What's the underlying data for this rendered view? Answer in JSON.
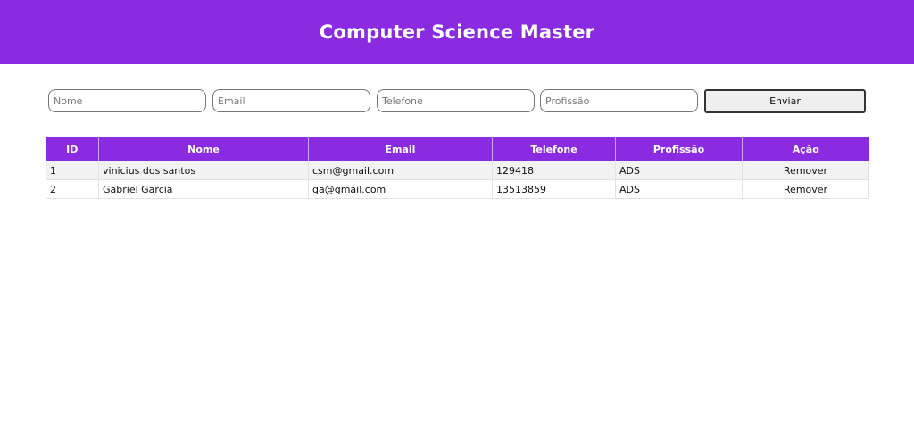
{
  "header": {
    "title": "Computer Science Master"
  },
  "form": {
    "nome_placeholder": "Nome",
    "email_placeholder": "Email",
    "telefone_placeholder": "Telefone",
    "profissao_placeholder": "Profissão",
    "submit_label": "Enviar"
  },
  "table": {
    "headers": [
      "ID",
      "Nome",
      "Email",
      "Telefone",
      "Profissão",
      "Ação"
    ],
    "rows": [
      {
        "id": "1",
        "nome": "vinicius dos santos",
        "email": "csm@gmail.com",
        "telefone": "129418",
        "profissao": "ADS",
        "acao": "Remover"
      },
      {
        "id": "2",
        "nome": "Gabriel Garcia",
        "email": "ga@gmail.com",
        "telefone": "13513859",
        "profissao": "ADS",
        "acao": "Remover"
      }
    ]
  },
  "colors": {
    "accent": "#8a2be2",
    "row_stripe": "#f2f2f2"
  }
}
